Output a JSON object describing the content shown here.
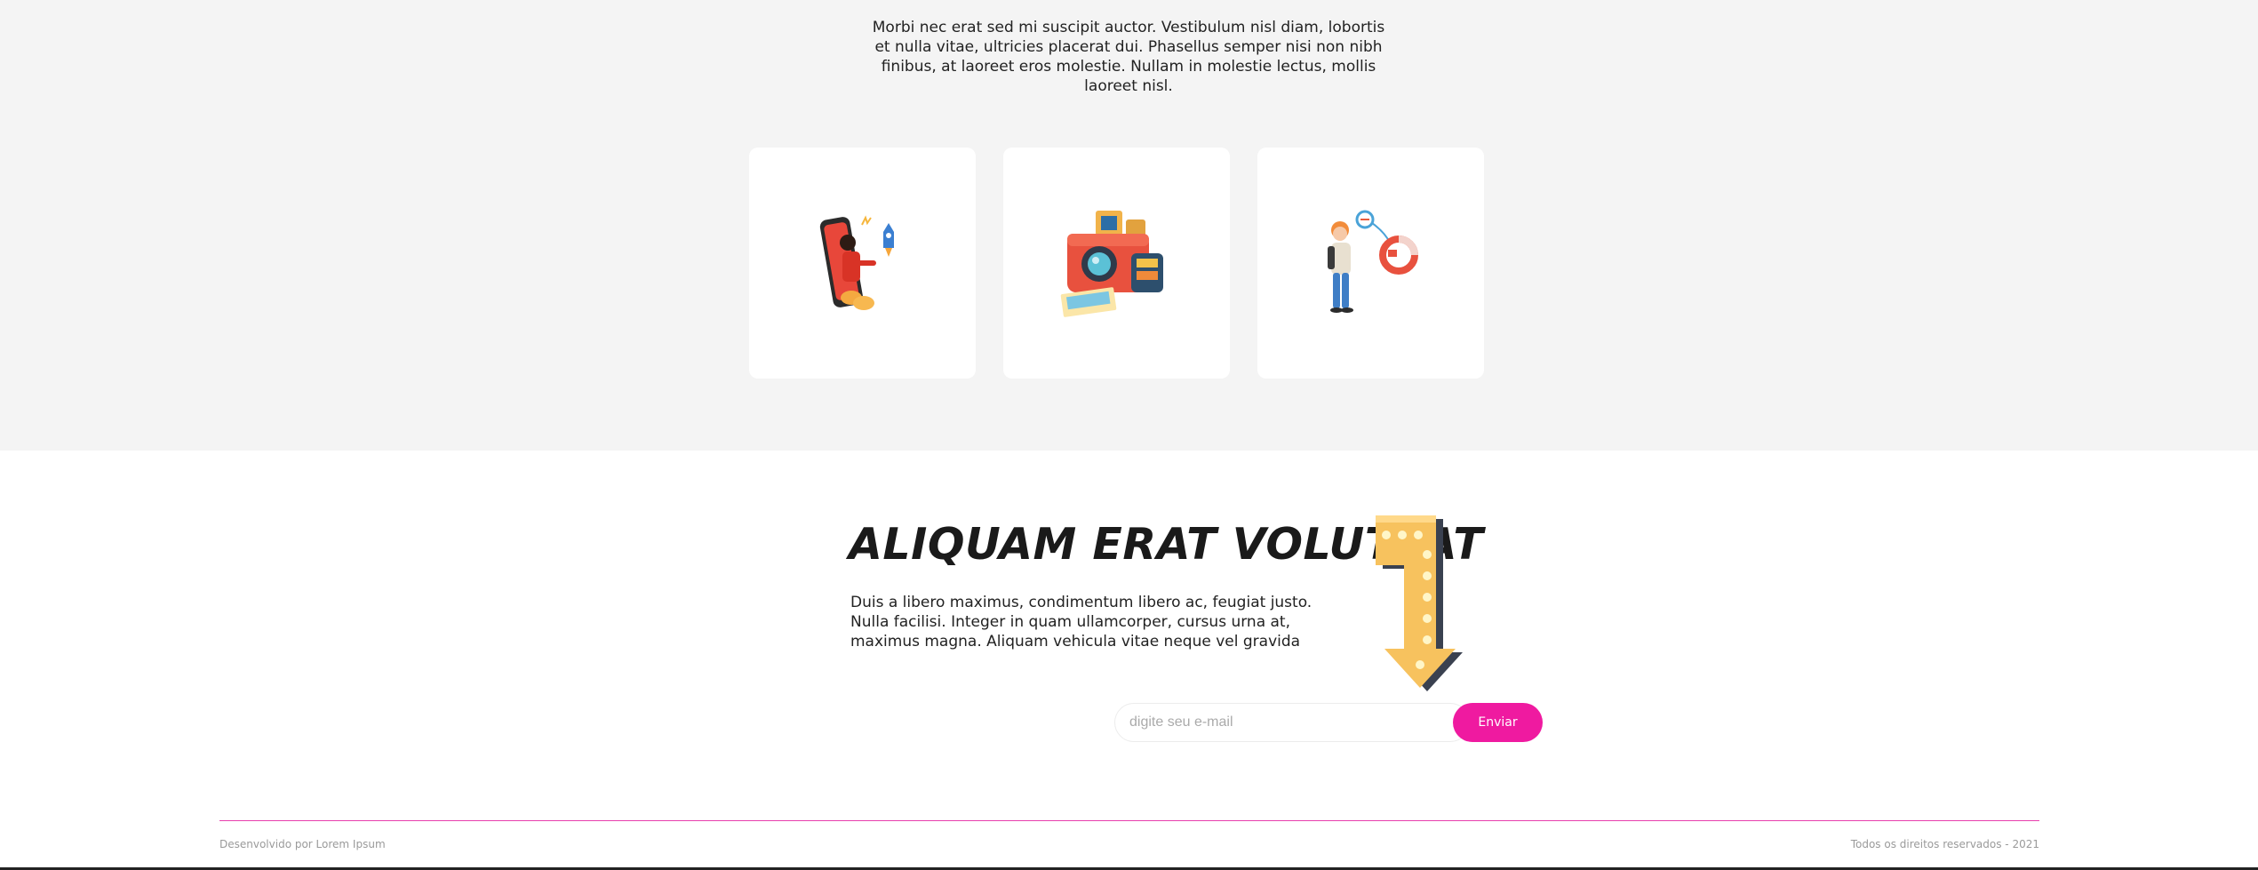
{
  "intro": {
    "text": "Morbi nec erat sed mi suscipit auctor. Vestibulum nisl diam, lobortis et nulla vitae, ultricies placerat dui. Phasellus semper nisi non nibh finibus, at laoreet eros molestie. Nullam in molestie lectus, mollis laoreet nisl."
  },
  "cards": [
    {
      "icon": "phone-rocket-illustration"
    },
    {
      "icon": "instant-camera-illustration"
    },
    {
      "icon": "person-chart-illustration"
    }
  ],
  "cta": {
    "title": "ALIQUAM ERAT VOLUTPAT",
    "body": "Duis a libero maximus, condimentum libero ac, feugiat justo. Nulla facilisi. Integer in quam ullamcorper, cursus urna at, maximus magna. Aliquam vehicula vitae neque vel gravida",
    "arrow_icon": "marquee-arrow-illustration"
  },
  "newsletter": {
    "placeholder": "digite seu e-mail",
    "button_label": "Enviar"
  },
  "footer": {
    "left": "Desenvolvido por Lorem Ipsum",
    "right": "Todos os direitos reservados - 2021"
  },
  "colors": {
    "accent": "#ef1aa0",
    "section_bg": "#f4f4f4"
  }
}
